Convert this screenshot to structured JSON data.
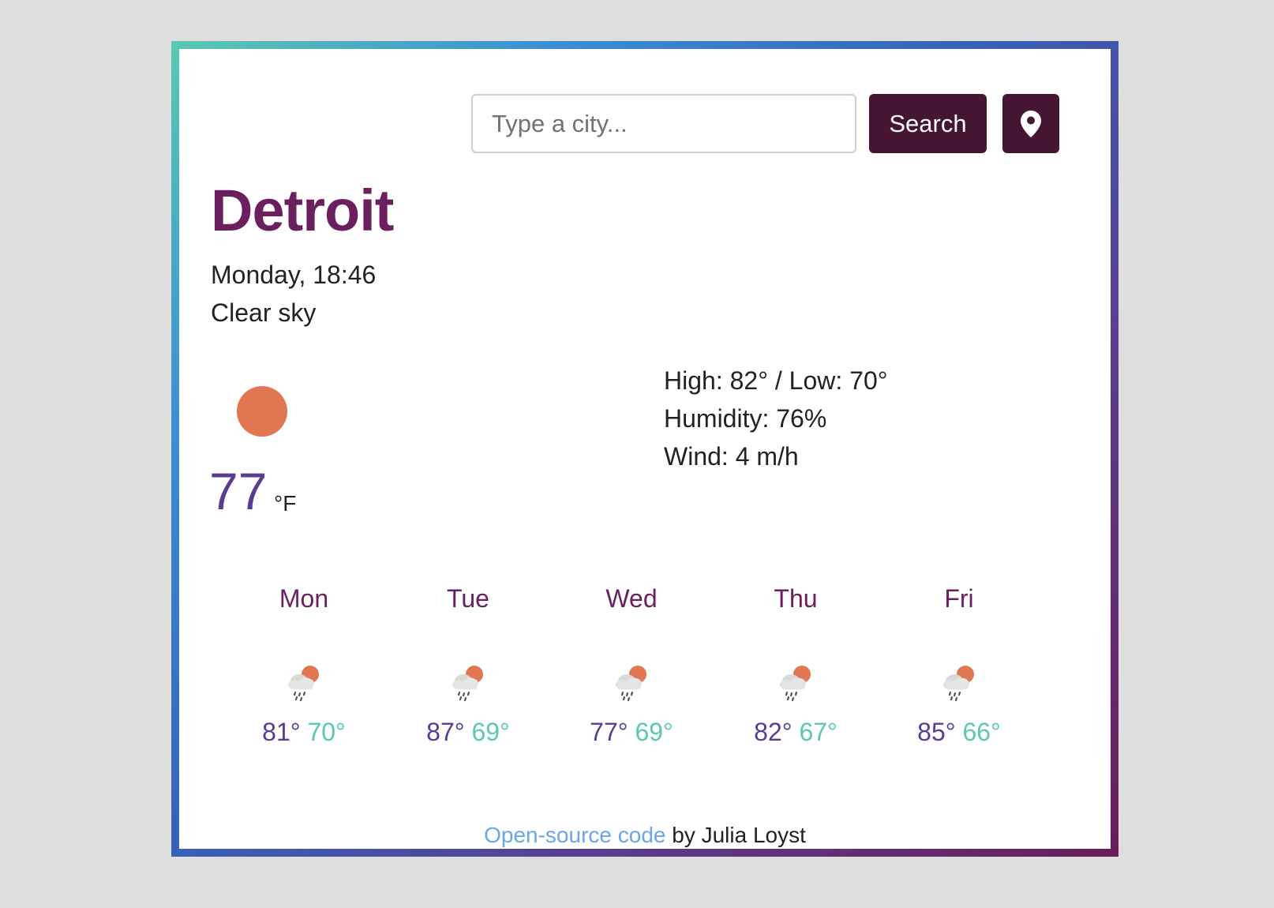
{
  "search": {
    "placeholder": "Type a city...",
    "value": "",
    "button_label": "Search",
    "location_icon": "map-marker-icon"
  },
  "current": {
    "city": "Detroit",
    "datetime": "Monday, 18:46",
    "description": "Clear sky",
    "icon": "sun-icon",
    "temperature": "77",
    "unit": "°F",
    "high_low": "High: 82° / Low: 70°",
    "humidity": "Humidity: 76%",
    "wind": "Wind: 4 m/h"
  },
  "forecast": [
    {
      "day": "Mon",
      "max": "81°",
      "min": "70°",
      "icon": "rain-sun-cloud-icon"
    },
    {
      "day": "Tue",
      "max": "87°",
      "min": "69°",
      "icon": "rain-sun-cloud-icon"
    },
    {
      "day": "Wed",
      "max": "77°",
      "min": "69°",
      "icon": "rain-sun-cloud-icon"
    },
    {
      "day": "Thu",
      "max": "82°",
      "min": "67°",
      "icon": "rain-sun-cloud-icon"
    },
    {
      "day": "Fri",
      "max": "85°",
      "min": "66°",
      "icon": "rain-sun-cloud-icon"
    }
  ],
  "footer": {
    "link_text": "Open-source code",
    "suffix": " by Julia Loyst"
  },
  "colors": {
    "accent_dark": "#461533",
    "city": "#6b1f5e",
    "temp_max": "#5a3d8f",
    "temp_min": "#5bc9b1",
    "sun": "#e07752",
    "link": "#6aa6e8"
  }
}
